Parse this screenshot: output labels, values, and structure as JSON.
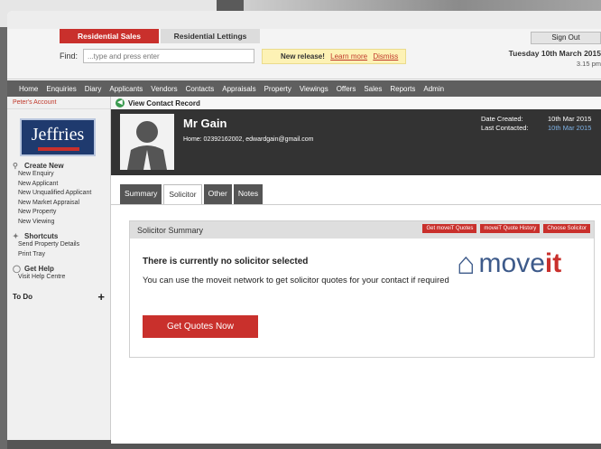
{
  "top_tabs": {
    "sales": "Residential Sales",
    "lettings": "Residential Lettings"
  },
  "search": {
    "label": "Find:",
    "placeholder": "...type and press enter"
  },
  "release": {
    "title": "New release!",
    "learn": "Learn more",
    "dismiss": "Dismiss"
  },
  "account": {
    "signout": "Sign Out",
    "date": "Tuesday 10th March 2015",
    "time": "3.15 pm"
  },
  "nav": [
    "Home",
    "Enquiries",
    "Diary",
    "Applicants",
    "Vendors",
    "Contacts",
    "Appraisals",
    "Property",
    "Viewings",
    "Offers",
    "Sales",
    "Reports",
    "Admin"
  ],
  "sidebar": {
    "account_link": "Peter's Account",
    "logo": "Jeffries",
    "create_new": "Create New",
    "create_links": [
      "New Enquiry",
      "New Applicant",
      "New Unqualified Applicant",
      "New Market Appraisal",
      "New Property",
      "New Viewing"
    ],
    "shortcuts": "Shortcuts",
    "shortcut_links": [
      "Send Property Details",
      "Print Tray"
    ],
    "get_help": "Get Help",
    "help_links": [
      "Visit Help Centre"
    ],
    "todo": "To Do"
  },
  "contact": {
    "header": "View Contact Record",
    "name": "Mr Gain",
    "details": "Home: 02392162002, edwardgain@gmail.com",
    "created_label": "Date Created:",
    "created_value": "10th Mar 2015",
    "contacted_label": "Last Contacted:",
    "contacted_value": "10th Mar 2015"
  },
  "tabs": [
    "Summary",
    "Solicitor",
    "Other",
    "Notes"
  ],
  "solicitor": {
    "title": "Solicitor Summary",
    "buttons": [
      "Get moveiT Quotes",
      "moveiT Quote History",
      "Choose Solicitor"
    ],
    "none_selected": "There is currently no solicitor selected",
    "description": "You can use the moveit network to get solicitor quotes for your contact if required",
    "cta": "Get Quotes Now",
    "logo_a": "move",
    "logo_b": "it"
  }
}
